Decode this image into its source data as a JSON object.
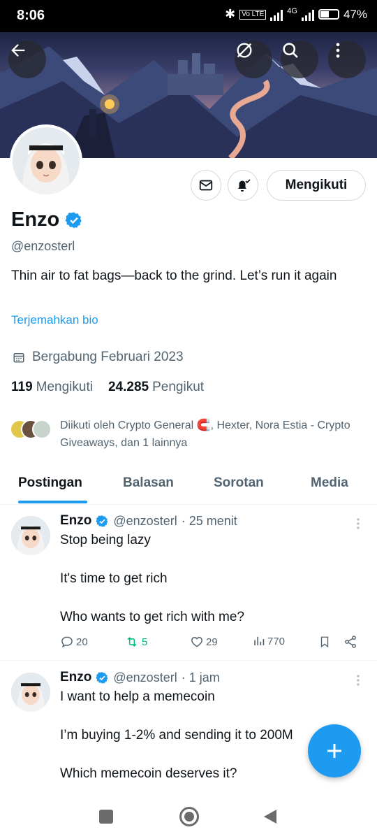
{
  "status_bar": {
    "time": "8:06",
    "battery": "47%",
    "network": "4G"
  },
  "profile": {
    "name": "Enzo",
    "handle": "@enzosterl",
    "bio": "Thin air to fat bags—back to the grind. Let’s run it again",
    "translate_label": "Terjemahkan bio",
    "joined": "Bergabung Februari 2023",
    "following_count": "119",
    "following_label": "Mengikuti",
    "followers_count": "24.285",
    "followers_label": "Pengikut",
    "followed_by": "Diikuti oleh Crypto General 🧲, Hexter, Nora Estia - Crypto Giveaways, dan 1 lainnya",
    "follow_button": "Mengikuti",
    "verified_color": "#1d9bf0"
  },
  "tabs": [
    {
      "label": "Postingan",
      "active": true
    },
    {
      "label": "Balasan",
      "active": false
    },
    {
      "label": "Sorotan",
      "active": false
    },
    {
      "label": "Media",
      "active": false
    }
  ],
  "posts": [
    {
      "name": "Enzo",
      "handle": "@enzosterl",
      "time": "· 25 menit",
      "lines": [
        "Stop being lazy",
        "It's time to get rich",
        "Who wants to get rich with me?"
      ],
      "replies": "20",
      "reposts": "5",
      "likes": "29",
      "views": "770"
    },
    {
      "name": "Enzo",
      "handle": "@enzosterl",
      "time": "· 1 jam",
      "lines": [
        "I want to help a memecoin",
        "I’m buying 1-2% and sending it to 200M",
        "Which memecoin deserves it?"
      ]
    }
  ],
  "icons": {
    "back": "back-arrow-icon",
    "grok": "grok-icon",
    "search": "search-icon",
    "more": "more-vertical-icon",
    "message": "envelope-icon",
    "notify": "bell-check-icon",
    "compose": "plus-icon"
  },
  "colors": {
    "accent": "#1d9bf0",
    "repost_active": "#00ba7c"
  }
}
